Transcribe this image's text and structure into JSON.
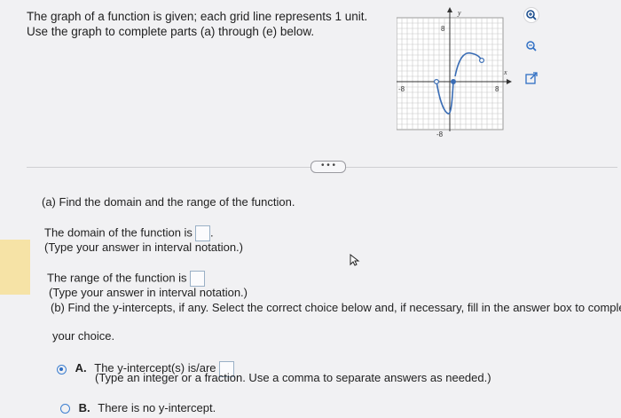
{
  "intro": {
    "line1": "The graph of a function is given; each grid line represents 1 unit.",
    "line2": "Use the graph to complete parts (a) through (e) below."
  },
  "graph": {
    "axis_labels": {
      "x": "x",
      "y": "y"
    },
    "ticks": {
      "y_top": "8",
      "y_bottom": "-8",
      "x_left": "-8",
      "x_right": "8"
    },
    "curve_color": "#3a6db5"
  },
  "tools": {
    "zoom_in": "magnify-plus-icon",
    "zoom_out": "magnify-minus-icon",
    "popout": "popout-icon"
  },
  "more_button": "• • •",
  "part_a": {
    "question": "(a) Find the domain and the range of the function.",
    "domain_prompt": "The domain of the function is",
    "domain_note": "(Type your answer in interval notation.)",
    "range_prompt": "The range of the function is",
    "range_note": "(Type your answer in interval notation.)"
  },
  "part_b": {
    "question_line1": "(b) Find the y-intercepts, if any. Select the correct choice below and, if necessary, fill in the answer box to complete",
    "question_line2": "your choice.",
    "option_a_letter": "A.",
    "option_a_text": "The y-intercept(s) is/are",
    "option_a_note": "(Type an integer or a fraction. Use a comma to separate answers as needed.)",
    "option_b_letter": "B.",
    "option_b_text": "There is no y-intercept.",
    "selected": "A"
  }
}
